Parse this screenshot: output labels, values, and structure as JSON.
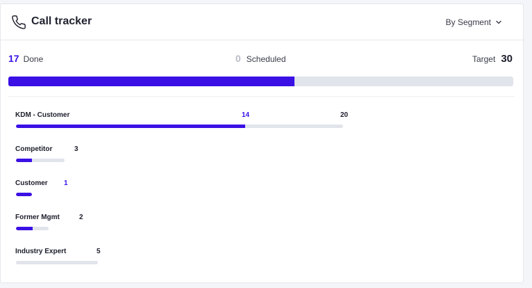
{
  "header": {
    "title": "Call tracker",
    "segment_select": "By Segment",
    "phone_icon": "phone-icon",
    "chevron_icon": "chevron-down-icon"
  },
  "summary": {
    "done_count": "17",
    "done_label": "Done",
    "scheduled_count": "0",
    "scheduled_label": "Scheduled",
    "target_label": "Target",
    "target_count": "30",
    "progress": 0.567
  },
  "segments": [
    {
      "name": "KDM - Customer",
      "count": "14",
      "target": "20",
      "progress": 0.7,
      "count_color": "#3a10e5"
    },
    {
      "name": "Competitor",
      "count": "3",
      "target": "",
      "progress": 0.33,
      "count_color": "#1c1d2b"
    },
    {
      "name": "Customer",
      "count": "1",
      "target": "",
      "progress": 1.0,
      "count_color": "#3a10e5"
    },
    {
      "name": "Former Mgmt",
      "count": "2",
      "target": "",
      "progress": 0.5,
      "count_color": "#1c1d2b"
    },
    {
      "name": "Industry Expert",
      "count": "5",
      "target": "",
      "progress": 0.0,
      "count_color": "#1c1d2b"
    }
  ],
  "colors": {
    "accent": "#3a10e5",
    "track": "#e1e4eb"
  }
}
